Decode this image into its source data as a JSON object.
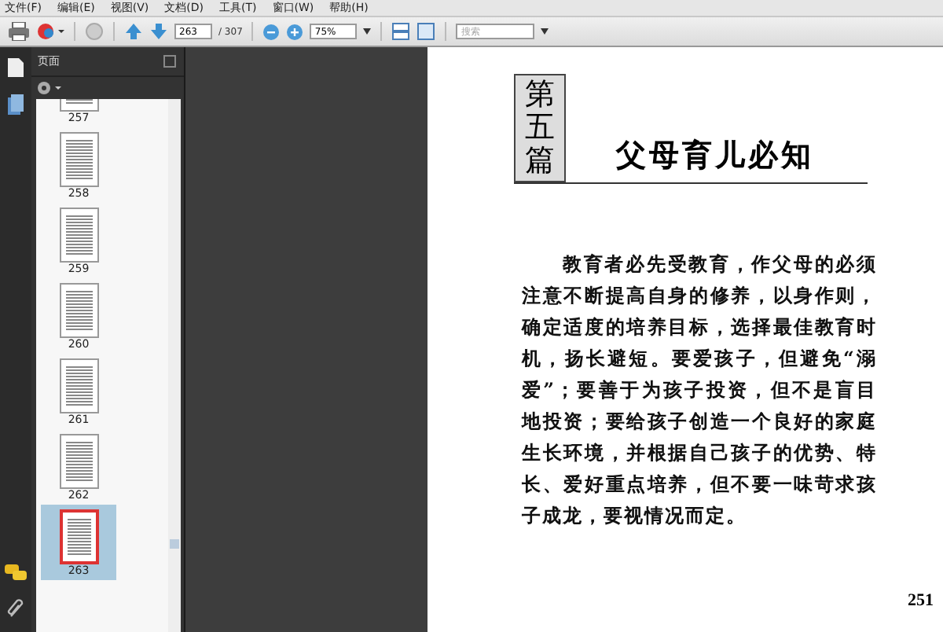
{
  "menu_bar": [
    "文件(F)",
    "编辑(E)",
    "视图(V)",
    "文档(D)",
    "工具(T)",
    "窗口(W)",
    "帮助(H)"
  ],
  "toolbar": {
    "page_number": "263",
    "page_total": "/ 307",
    "zoom": "75%",
    "search": {
      "placeholder": "搜索"
    }
  },
  "panel": {
    "title": "页面",
    "thumbnails": [
      {
        "label": "257",
        "selected": false
      },
      {
        "label": "258",
        "selected": false
      },
      {
        "label": "259",
        "selected": false
      },
      {
        "label": "260",
        "selected": false
      },
      {
        "label": "261",
        "selected": false
      },
      {
        "label": "262",
        "selected": false
      },
      {
        "label": "263",
        "selected": true
      }
    ]
  },
  "document": {
    "part_label": "第五篇",
    "title": "父母育儿必知",
    "paragraph": "教育者必先受教育，作父母的必须注意不断提高自身的修养，以身作则，确定适度的培养目标，选择最佳教育时机，扬长避短。要爱孩子，但避免“溺爱”；要善于为孩子投资，但不是盲目地投资；要给孩子创造一个良好的家庭生长环境，并根据自己孩子的优势、特长、爱好重点培养，但不要一味苛求孩子成龙，要视情况而定。",
    "page_number": "251"
  }
}
